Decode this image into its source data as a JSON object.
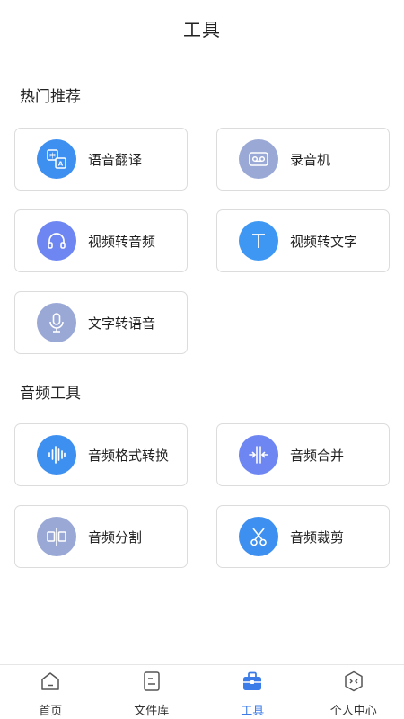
{
  "header": {
    "title": "工具"
  },
  "sections": [
    {
      "title": "热门推荐",
      "items": [
        {
          "label": "语音翻译",
          "icon": "translate-icon",
          "color": "#3d8ff0"
        },
        {
          "label": "录音机",
          "icon": "cassette-icon",
          "color": "#9aa8d6"
        },
        {
          "label": "视频转音频",
          "icon": "headphones-icon",
          "color": "#6e86f2"
        },
        {
          "label": "视频转文字",
          "icon": "text-t-icon",
          "color": "#3d97f3"
        },
        {
          "label": "文字转语音",
          "icon": "microphone-icon",
          "color": "#9aa8d6"
        }
      ]
    },
    {
      "title": "音频工具",
      "items": [
        {
          "label": "音频格式转换",
          "icon": "waveform-icon",
          "color": "#3d8ff0"
        },
        {
          "label": "音频合并",
          "icon": "merge-icon",
          "color": "#6e86f2"
        },
        {
          "label": "音频分割",
          "icon": "split-icon",
          "color": "#9aa8d6"
        },
        {
          "label": "音频裁剪",
          "icon": "scissors-icon",
          "color": "#3d8ff0"
        }
      ]
    }
  ],
  "tabbar": {
    "items": [
      {
        "label": "首页",
        "icon": "home-icon",
        "active": false
      },
      {
        "label": "文件库",
        "icon": "file-icon",
        "active": false
      },
      {
        "label": "工具",
        "icon": "toolbox-icon",
        "active": true
      },
      {
        "label": "个人中心",
        "icon": "profile-icon",
        "active": false
      }
    ],
    "active_color": "#3b7ce9",
    "inactive_color": "#333333"
  }
}
